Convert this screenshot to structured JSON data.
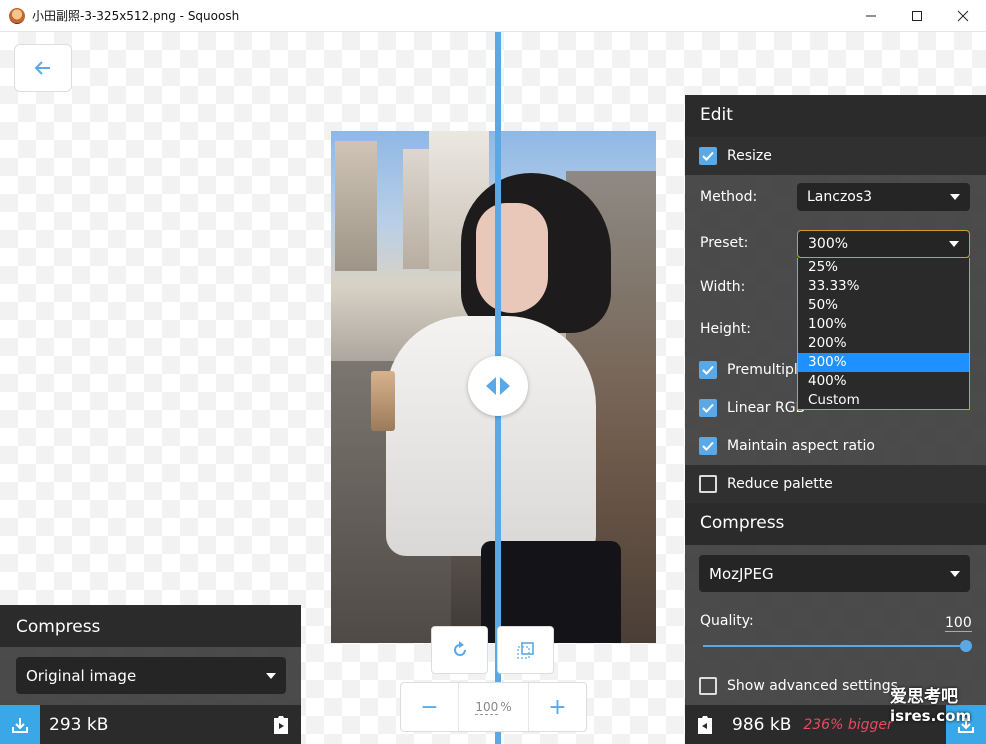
{
  "window": {
    "title": "小田副照-3-325x512.png - Squoosh",
    "minimize_icon": "minimize-icon",
    "maximize_icon": "maximize-icon",
    "close_icon": "close-icon"
  },
  "canvas": {
    "back_icon": "arrow-left-icon",
    "rotate_icon": "rotate-icon",
    "compare_icon": "compare-icon",
    "zoom": {
      "minus": "−",
      "value": "100",
      "unit": "%",
      "plus": "+"
    }
  },
  "left_panel": {
    "header": "Compress",
    "select_value": "Original image",
    "size": "293 kB"
  },
  "right_panel": {
    "edit_header": "Edit",
    "resize_label": "Resize",
    "method_label": "Method:",
    "method_value": "Lanczos3",
    "preset_label": "Preset:",
    "preset_value": "300%",
    "preset_options": [
      "25%",
      "33.33%",
      "50%",
      "100%",
      "200%",
      "300%",
      "400%",
      "Custom"
    ],
    "preset_selected_index": 5,
    "width_label": "Width:",
    "height_label": "Height:",
    "premultiply_label": "Premultipl",
    "linear_rgb_label": "Linear RGB",
    "maintain_aspect_label": "Maintain aspect ratio",
    "reduce_palette_label": "Reduce palette",
    "compress_header": "Compress",
    "codec_value": "MozJPEG",
    "quality_label": "Quality:",
    "quality_value": "100",
    "advanced_label": "Show advanced settings",
    "size": "986 kB",
    "size_delta": "236% bigger"
  },
  "watermark": {
    "line1": "爱思考吧",
    "line2": "isres.com"
  },
  "colors": {
    "accent": "#5aa9e6",
    "dark_header": "#2b2b2b",
    "highlight": "#1e90ff",
    "bigger": "#e84a5f"
  }
}
